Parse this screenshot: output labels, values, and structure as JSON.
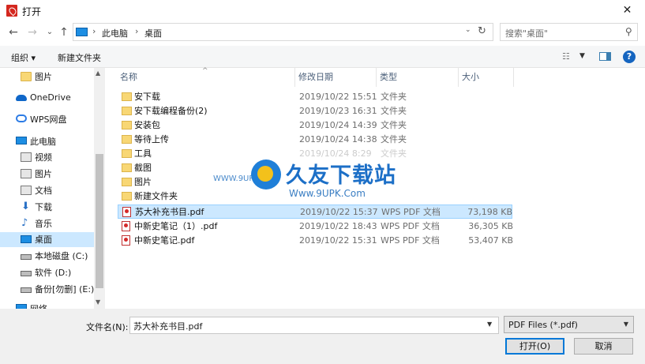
{
  "window": {
    "title": "打开",
    "close_glyph": "✕"
  },
  "nav": {
    "back": "←",
    "forward": "→",
    "recent": "⌄",
    "up": "↑",
    "refresh": "↻",
    "breadcrumb": [
      "此电脑",
      "桌面"
    ],
    "crumb_separator": "›",
    "search_placeholder": "搜索\"桌面\""
  },
  "toolbar": {
    "organize": "组织 ▾",
    "new_folder": "新建文件夹"
  },
  "sidebar": {
    "items": [
      {
        "label": "图片",
        "icon": "folder-icon"
      },
      {
        "label": "OneDrive",
        "icon": "onedrive-icon"
      },
      {
        "label": "WPS网盘",
        "icon": "wps-cloud-icon"
      },
      {
        "label": "此电脑",
        "icon": "pc-icon"
      },
      {
        "label": "视频",
        "icon": "video-icon"
      },
      {
        "label": "图片",
        "icon": "pictures-icon"
      },
      {
        "label": "文档",
        "icon": "documents-icon"
      },
      {
        "label": "下载",
        "icon": "download-icon"
      },
      {
        "label": "音乐",
        "icon": "music-icon"
      },
      {
        "label": "桌面",
        "icon": "desktop-icon",
        "selected": true
      },
      {
        "label": "本地磁盘 (C:)",
        "icon": "drive-icon"
      },
      {
        "label": "软件 (D:)",
        "icon": "drive-icon"
      },
      {
        "label": "备份[勿删] (E:)",
        "icon": "drive-icon"
      },
      {
        "label": "网络",
        "icon": "network-icon"
      }
    ]
  },
  "columns": {
    "name": "名称",
    "date": "修改日期",
    "type": "类型",
    "size": "大小"
  },
  "files": [
    {
      "name": "安下载",
      "date": "2019/10/22 15:51",
      "type": "文件夹",
      "size": "",
      "kind": "folder"
    },
    {
      "name": "安下载编程备份(2)",
      "date": "2019/10/23 16:31",
      "type": "文件夹",
      "size": "",
      "kind": "folder"
    },
    {
      "name": "安装包",
      "date": "2019/10/24 14:39",
      "type": "文件夹",
      "size": "",
      "kind": "folder"
    },
    {
      "name": "等待上传",
      "date": "2019/10/24 14:38",
      "type": "文件夹",
      "size": "",
      "kind": "folder"
    },
    {
      "name": "工具",
      "date": "2019/10/24 8:29",
      "type": "文件夹",
      "size": "",
      "kind": "folder"
    },
    {
      "name": "截图",
      "date": "",
      "type": "",
      "size": "",
      "kind": "folder"
    },
    {
      "name": "图片",
      "date": "",
      "type": "",
      "size": "",
      "kind": "folder"
    },
    {
      "name": "新建文件夹",
      "date": "",
      "type": "",
      "size": "",
      "kind": "folder"
    },
    {
      "name": "苏大补充书目.pdf",
      "date": "2019/10/22 15:37",
      "type": "WPS PDF 文档",
      "size": "73,198 KB",
      "kind": "pdf",
      "selected": true
    },
    {
      "name": "中新史笔记（1）.pdf",
      "date": "2019/10/22 18:43",
      "type": "WPS PDF 文档",
      "size": "36,305 KB",
      "kind": "pdf"
    },
    {
      "name": "中新史笔记.pdf",
      "date": "2019/10/22 15:31",
      "type": "WPS PDF 文档",
      "size": "53,407 KB",
      "kind": "pdf"
    }
  ],
  "watermark": {
    "title": "久友下载站",
    "url": "Www.9UPK.Com",
    "url_left": "WWW.9UPK.COM"
  },
  "footer": {
    "filename_label": "文件名(N):",
    "filename_value": "苏大补充书目.pdf",
    "filetype_value": "PDF Files (*.pdf)",
    "open_button": "打开(O)",
    "cancel_button": "取消"
  },
  "colors": {
    "accent": "#0078d7",
    "selection": "#cce8ff",
    "folder": "#f8d775",
    "pdf": "#d42a2a"
  }
}
